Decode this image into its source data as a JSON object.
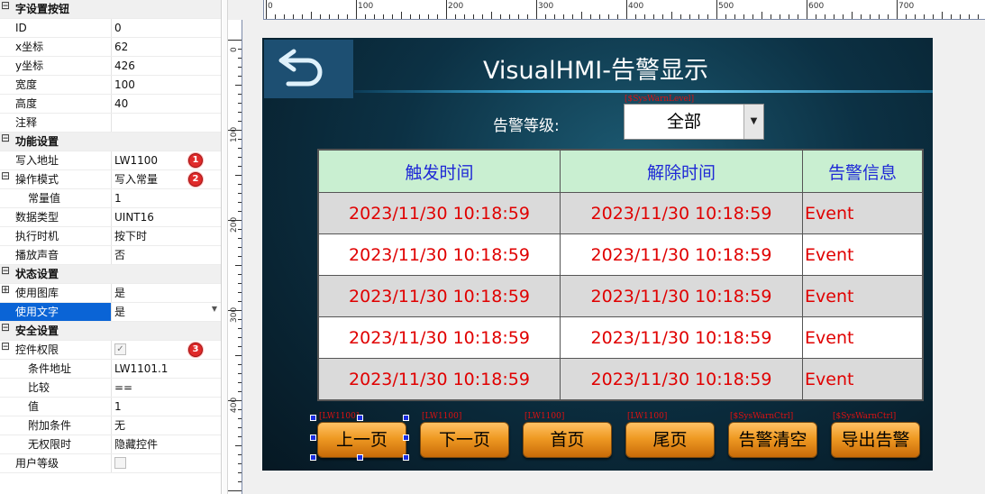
{
  "props": {
    "rows": [
      {
        "type": "cat",
        "toggle": "⊟",
        "key": "字设置按钮"
      },
      {
        "type": "prop",
        "key": "ID",
        "value": "0"
      },
      {
        "type": "prop",
        "key": "x坐标",
        "value": "62"
      },
      {
        "type": "prop",
        "key": "y坐标",
        "value": "426"
      },
      {
        "type": "prop",
        "key": "宽度",
        "value": "100"
      },
      {
        "type": "prop",
        "key": "高度",
        "value": "40"
      },
      {
        "type": "prop",
        "key": "注释",
        "value": ""
      },
      {
        "type": "cat",
        "toggle": "⊟",
        "key": "功能设置"
      },
      {
        "type": "prop",
        "key": "写入地址",
        "value": "LW1100",
        "badge": "1"
      },
      {
        "type": "prop",
        "key": "操作模式",
        "value": "写入常量",
        "toggle": "⊟",
        "badge": "2"
      },
      {
        "type": "prop",
        "key": "常量值",
        "value": "1",
        "indent": true
      },
      {
        "type": "prop",
        "key": "数据类型",
        "value": "UINT16"
      },
      {
        "type": "prop",
        "key": "执行时机",
        "value": "按下时"
      },
      {
        "type": "prop",
        "key": "播放声音",
        "value": "否"
      },
      {
        "type": "cat",
        "toggle": "⊟",
        "key": "状态设置"
      },
      {
        "type": "prop",
        "key": "使用图库",
        "value": "是",
        "toggle": "⊞"
      },
      {
        "type": "prop",
        "key": "使用文字",
        "value": "是",
        "toggle": "⊞",
        "selected": true,
        "dropdown": "▼"
      },
      {
        "type": "cat",
        "toggle": "⊟",
        "key": "安全设置"
      },
      {
        "type": "prop",
        "key": "控件权限",
        "value": "",
        "toggle": "⊟",
        "check": "✓",
        "badge": "3"
      },
      {
        "type": "prop",
        "key": "条件地址",
        "value": "LW1101.1",
        "indent": true
      },
      {
        "type": "prop",
        "key": "比较",
        "value": "==",
        "indent": true
      },
      {
        "type": "prop",
        "key": "值",
        "value": "1",
        "indent": true
      },
      {
        "type": "prop",
        "key": "附加条件",
        "value": "无",
        "indent": true
      },
      {
        "type": "prop",
        "key": "无权限时",
        "value": "隐藏控件",
        "indent": true
      },
      {
        "type": "prop",
        "key": "用户等级",
        "value": "",
        "check": ""
      }
    ]
  },
  "ruler": {
    "h_labels": [
      "0",
      "100",
      "200",
      "300",
      "400",
      "500",
      "600",
      "700"
    ],
    "v_labels": [
      "0",
      "100",
      "200",
      "300",
      "400"
    ]
  },
  "hmi": {
    "title": "VisualHMI-告警显示",
    "level_label": "告警等级:",
    "level_tag": "[$SysWarnLevel]",
    "level_value": "全部",
    "level_arrow": "▼",
    "table": {
      "headers": [
        "触发时间",
        "解除时间",
        "告警信息"
      ],
      "rows": [
        [
          "2023/11/30 10:18:59",
          "2023/11/30 10:18:59",
          "Event"
        ],
        [
          "2023/11/30 10:18:59",
          "2023/11/30 10:18:59",
          "Event"
        ],
        [
          "2023/11/30 10:18:59",
          "2023/11/30 10:18:59",
          "Event"
        ],
        [
          "2023/11/30 10:18:59",
          "2023/11/30 10:18:59",
          "Event"
        ],
        [
          "2023/11/30 10:18:59",
          "2023/11/30 10:18:59",
          "Event"
        ]
      ]
    },
    "buttons": [
      {
        "label": "上一页",
        "tag": "[LW1100]"
      },
      {
        "label": "下一页",
        "tag": "[LW1100]"
      },
      {
        "label": "首页",
        "tag": "[LW1100]"
      },
      {
        "label": "尾页",
        "tag": "[LW1100]"
      },
      {
        "label": "告警清空",
        "tag": "[$SysWarnCtrl]"
      },
      {
        "label": "导出告警",
        "tag": "[$SysWarnCtrl]"
      }
    ]
  },
  "colors": {
    "selection_blue": "#0a64d6",
    "header_green": "#c9efd1",
    "event_red": "#e00000",
    "header_text_blue": "#1f29d6",
    "button_orange": "#ef9a23",
    "tag_red": "#d11111"
  }
}
